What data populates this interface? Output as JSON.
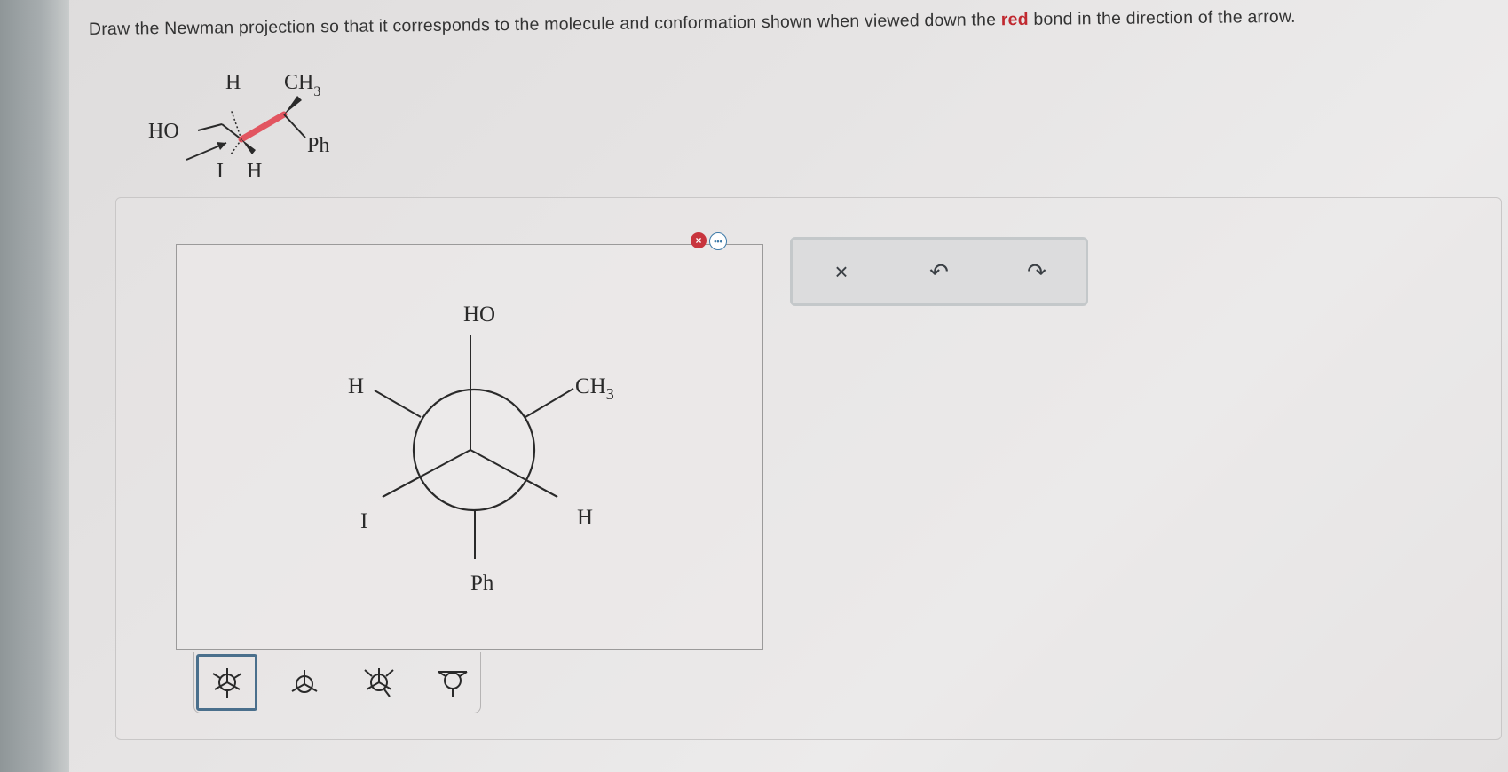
{
  "question": {
    "before": "Draw the Newman projection so that it corresponds to the molecule and conformation shown when viewed down the ",
    "highlight": "red",
    "after": " bond in the direction of the arrow."
  },
  "molecule": {
    "labels": {
      "h_top": "H",
      "ch3": "CH",
      "ch3_sub": "3",
      "ho": "HO",
      "ph": "Ph",
      "i": "I",
      "h_bottom": "H"
    },
    "red_bond_color": "#e25560"
  },
  "newman": {
    "front": {
      "top": "HO",
      "lower_left": "I",
      "lower_right": "H"
    },
    "back": {
      "upper_left": "H",
      "upper_right": "CH",
      "upper_right_sub": "3",
      "bottom": "Ph"
    }
  },
  "status": {
    "error_icon": "x-circle-icon",
    "more_icon": "ellipsis-icon",
    "more_text": "•••"
  },
  "toolbar": {
    "tools": [
      "newman-staggered-tool",
      "newman-front-only-tool",
      "newman-eclipsed-tool",
      "newman-back-only-tool"
    ],
    "selected_index": 0
  },
  "actions": {
    "clear": "×",
    "undo": "↶",
    "redo": "↷"
  },
  "colors": {
    "accent_red": "#c0282f",
    "selected_border": "#4a6f8c",
    "error": "#c8343d",
    "info": "#3d7aa8"
  }
}
